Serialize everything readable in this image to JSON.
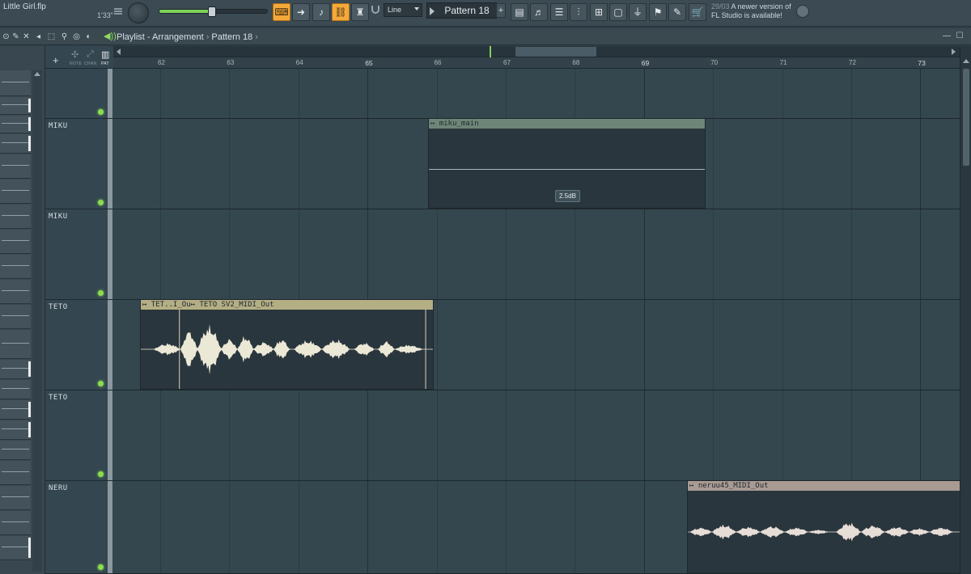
{
  "project": {
    "title": "Little Girl.flp",
    "time": "1'33\""
  },
  "toolbar": {
    "snap_mode": "Line",
    "pattern_name": "Pattern 18",
    "pattern_add": "+",
    "news_date": "29/03",
    "news_message": "A newer version of FL Studio is available!",
    "icons": [
      "typing-keyboard-icon",
      "arrow-right-icon",
      "step-icon",
      "link-icon",
      "metronome-icon",
      "playlist-icon",
      "piano-roll-icon",
      "channel-rack-icon",
      "mixer-icon",
      "browser-icon",
      "plugin-icon",
      "plug-icon",
      "tempo-icon",
      "wizard-icon",
      "cart-icon"
    ],
    "accent_color": "#f4a93b",
    "volume_level": 0.48
  },
  "playlist": {
    "title_prefix": "Playlist",
    "title_view": "Arrangement",
    "title_pattern": "Pattern 18",
    "separator": "›",
    "mode_labels": [
      "NOTE",
      "CHAN",
      "PAT"
    ],
    "add_track": "+"
  },
  "ruler": {
    "bars": [
      62,
      63,
      64,
      65,
      66,
      67,
      68,
      69,
      70,
      71,
      72,
      73
    ],
    "major_bars": [
      65,
      69,
      73
    ]
  },
  "tracks": [
    {
      "name": ""
    },
    {
      "name": "MIKU"
    },
    {
      "name": "MIKU"
    },
    {
      "name": "TETO"
    },
    {
      "name": "TETO"
    },
    {
      "name": "NERU"
    }
  ],
  "clips": {
    "miku": {
      "label": "miku_main",
      "gain": "2.5dB",
      "color": "#6e8678"
    },
    "teto_a": {
      "label": "TET..I_Ou",
      "color": "#b4ae84"
    },
    "teto_b": {
      "label": "TETO SV2_MIDI_Out",
      "color": "#b4ae84"
    },
    "neru": {
      "label": "neruu45_MIDI_Out",
      "color": "#a99a93"
    }
  },
  "colors": {
    "led": "#8bdc4e",
    "waveform": "#ece8d6"
  }
}
